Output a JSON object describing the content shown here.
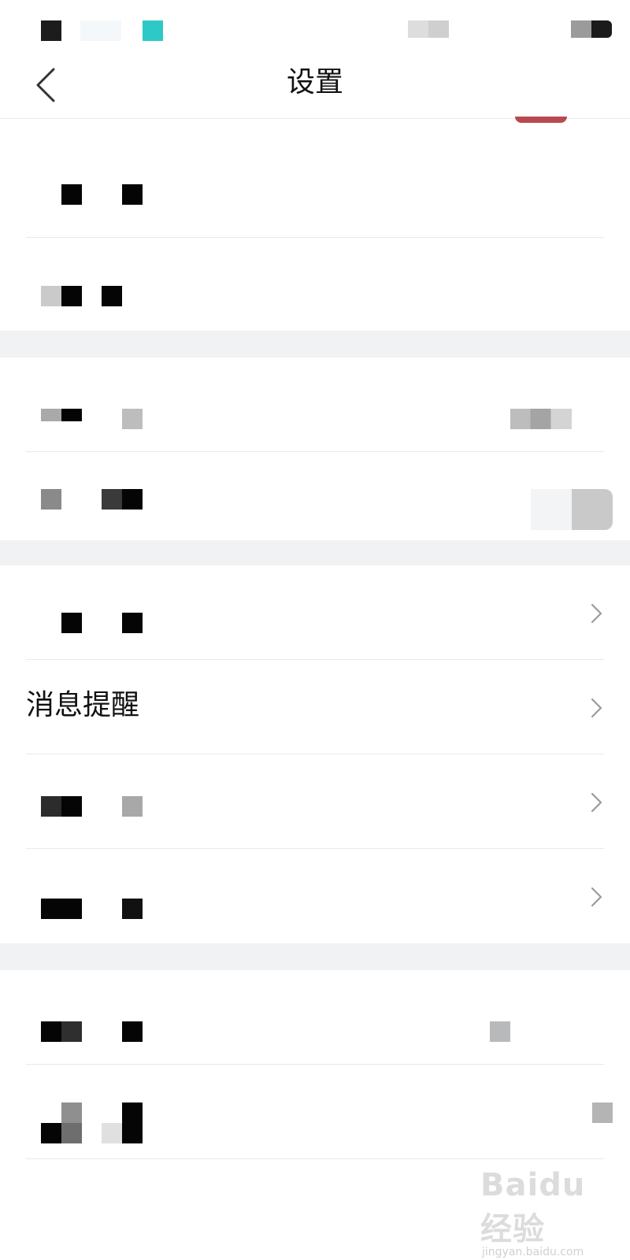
{
  "nav": {
    "title": "设置",
    "back_icon": "chevron-left-icon"
  },
  "rows": {
    "row1": {
      "label": ""
    },
    "row2": {
      "label": ""
    },
    "row3": {
      "label": "",
      "value": ""
    },
    "row4": {
      "label": ""
    },
    "row5": {
      "label": ""
    },
    "row6": {
      "label": "消息提醒"
    },
    "row7": {
      "label": ""
    },
    "row8": {
      "label": ""
    },
    "row9": {
      "label": "",
      "value": ""
    },
    "row10": {
      "label": ""
    }
  },
  "watermark": {
    "logo": "Baidu经验",
    "url": "jingyan.baidu.com"
  },
  "colors": {
    "page_background": "#ffffff",
    "section_gap": "#f1f2f4",
    "accent_teal": "#2dc9c6",
    "accent_red": "#b84a4f",
    "chevron": "#9a9a9a"
  }
}
